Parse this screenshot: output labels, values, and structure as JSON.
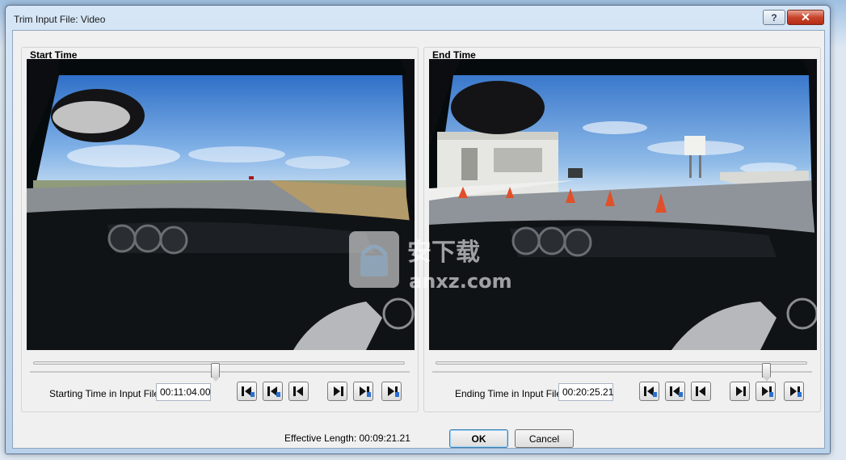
{
  "window": {
    "title": "Trim Input File: Video",
    "help_label": "?",
    "close_label": "✕"
  },
  "start": {
    "panel_title": "Start Time",
    "time_label": "Starting Time in Input File:",
    "time_value": "00:11:04.00",
    "slider_position_fraction": 0.49
  },
  "end": {
    "panel_title": "End Time",
    "time_label": "Ending Time in Input File:",
    "time_value": "00:20:25.21",
    "slider_position_fraction": 0.89
  },
  "nav_buttons": [
    {
      "icon": "step-back-3-icon"
    },
    {
      "icon": "step-back-2-icon"
    },
    {
      "icon": "step-back-1-icon"
    },
    {
      "icon": "step-forward-1-icon"
    },
    {
      "icon": "step-forward-2-icon"
    },
    {
      "icon": "step-forward-3-icon"
    }
  ],
  "footer": {
    "effective_length": "Effective Length: 00:09:21.21",
    "ok_label": "OK",
    "cancel_label": "Cancel"
  },
  "watermark": {
    "text_cn": "安下载",
    "text_en": "anxz.com"
  },
  "colors": {
    "accent_blue": "#2a6fd0",
    "sky": "#6fa3dc",
    "cone": "#e0502a",
    "close_red": "#c9442c"
  }
}
